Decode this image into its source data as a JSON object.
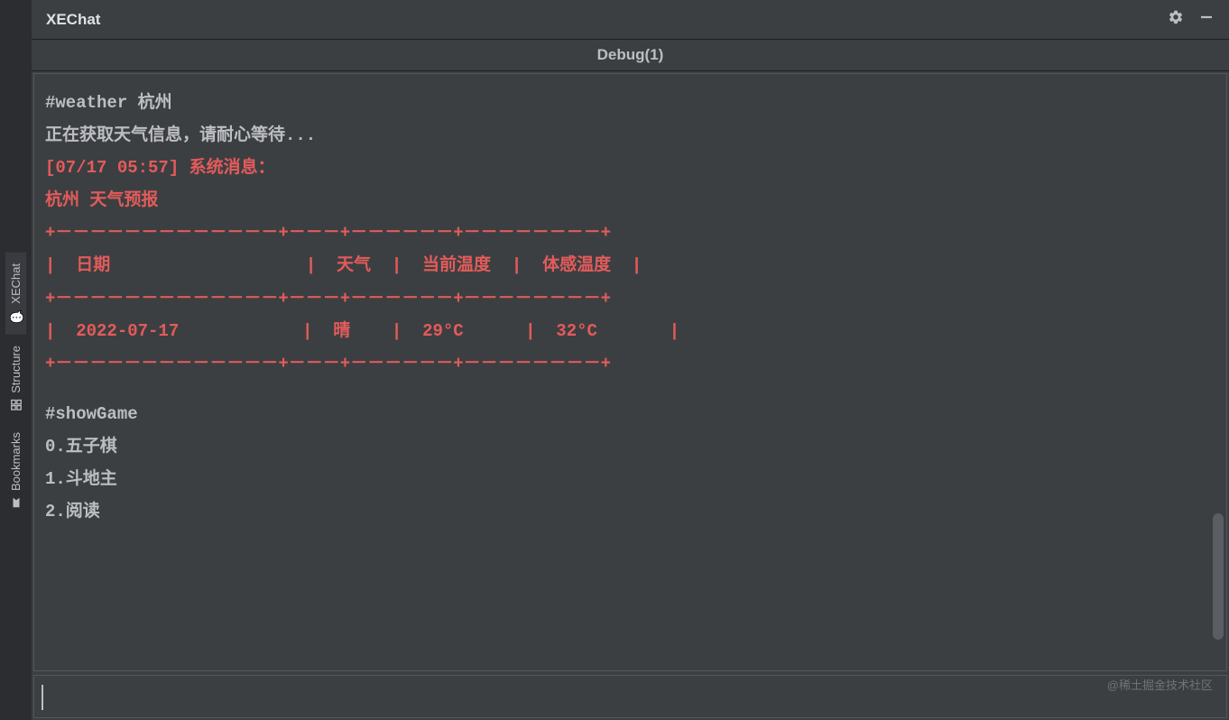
{
  "sidebar": {
    "tabs": [
      {
        "label": "XEChat",
        "icon": "chat-icon",
        "active": true
      },
      {
        "label": "Structure",
        "icon": "structure-icon",
        "active": false
      },
      {
        "label": "Bookmarks",
        "icon": "bookmark-icon",
        "active": false
      }
    ]
  },
  "titlebar": {
    "title": "XEChat"
  },
  "tabbar": {
    "label": "Debug(1)"
  },
  "console": {
    "command": "#weather 杭州",
    "loading": "正在获取天气信息，请耐心等待...",
    "system_prefix": "[07/17 05:57] 系统消息：",
    "forecast_title": "杭州 天气预报",
    "table_border_top": "+－－－－－－－－－－－－－+－－－+－－－－－－+－－－－－－－－+",
    "table_header_row": "|  日期                   |  天气  |  当前温度  |  体感温度  |",
    "table_border_mid": "+－－－－－－－－－－－－－+－－－+－－－－－－+－－－－－－－－+",
    "table_data_row": "|  2022-07-17            |  晴    |  29°C      |  32°C       |",
    "table_border_bot": "+－－－－－－－－－－－－－+－－－+－－－－－－+－－－－－－－－+",
    "game_command": "#showGame",
    "game_0": "0.五子棋",
    "game_1": "1.斗地主",
    "game_2": "2.阅读"
  },
  "watermark": "@稀土掘金技术社区",
  "weather_data": {
    "city": "杭州",
    "date": "2022-07-17",
    "condition": "晴",
    "current_temp": "29°C",
    "feels_like": "32°C",
    "timestamp": "07/17 05:57"
  },
  "colors": {
    "red": "#e45b5b",
    "grey": "#bcbec4",
    "bg": "#3c3f41",
    "dark": "#2b2d30"
  }
}
